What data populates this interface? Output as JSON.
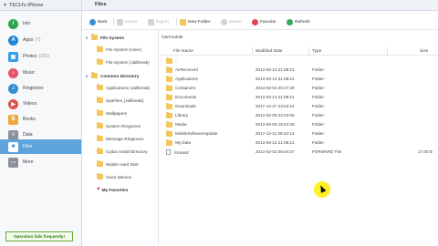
{
  "device": {
    "name": "TECH's iPhone"
  },
  "sidebar": {
    "items": [
      {
        "label": "Info",
        "count": "",
        "color": "#2ea44f"
      },
      {
        "label": "Apps",
        "count": "(7)",
        "color": "#1f86d8"
      },
      {
        "label": "Photos",
        "count": "(202)",
        "color": "#36a0e6"
      },
      {
        "label": "Music",
        "count": "",
        "color": "#e4546a"
      },
      {
        "label": "Ringtones",
        "count": "",
        "color": "#2f8fd6"
      },
      {
        "label": "Videos",
        "count": "",
        "color": "#d9534f"
      },
      {
        "label": "Books",
        "count": "",
        "color": "#f1a73c"
      },
      {
        "label": "Data",
        "count": "",
        "color": "#8a8f99"
      },
      {
        "label": "Files",
        "count": "",
        "color": "#3d8fd1"
      },
      {
        "label": "More",
        "count": "",
        "color": "#8a8f99"
      }
    ],
    "status": "Operation fails frequently!"
  },
  "tabs": {
    "files": "Files"
  },
  "toolbar": {
    "back": "Back",
    "import": "Import",
    "export": "Export",
    "new_folder": "New Folder",
    "delete": "Delete",
    "favorite": "Favorite",
    "refresh": "Refresh"
  },
  "tree": {
    "file_system": "File System",
    "file_system_user": "File System (User)",
    "file_system_jailbreak": "File System (Jailbreak)",
    "common_directory": "Common Directory",
    "common": [
      "Applications (Jailbreak)",
      "SpaFiles (Jailbreak)",
      "Wallpapers",
      "System Ringtones",
      "Message Ringtones",
      "Cydia Install Directory",
      "Mobile Hard Disk",
      "Voice Memos"
    ],
    "my_favorites": "My Favorites"
  },
  "path": "/var/mobile",
  "table": {
    "headers": {
      "name": "File Name",
      "modified": "Modified Date",
      "type": "Type",
      "size": "Size"
    },
    "rows": [
      {
        "name": "..",
        "modified": "",
        "type": "",
        "size": ""
      },
      {
        "name": "AirReceived",
        "modified": "2013-02-13 21:08:21",
        "type": "Folder",
        "size": ""
      },
      {
        "name": "Applications",
        "modified": "2013-02-13 21:08:21",
        "type": "Folder",
        "size": ""
      },
      {
        "name": "Containers",
        "modified": "2013-02-02 20:37:39",
        "type": "Folder",
        "size": ""
      },
      {
        "name": "Documents",
        "modified": "2013-02-13 21:08:21",
        "type": "Folder",
        "size": ""
      },
      {
        "name": "Downloads",
        "modified": "2017-12-27 22:02:24",
        "type": "Folder",
        "size": ""
      },
      {
        "name": "Library",
        "modified": "2013-02-09 22:04:08",
        "type": "Folder",
        "size": ""
      },
      {
        "name": "Media",
        "modified": "2013-02-09 15:24:28",
        "type": "Folder",
        "size": ""
      },
      {
        "name": "MobileSoftwareUpdate",
        "modified": "2017-12-11 09:42:14",
        "type": "Folder",
        "size": ""
      },
      {
        "name": "My Data",
        "modified": "2013-02-12 21:08:21",
        "type": "Folder",
        "size": ""
      },
      {
        "name": ".forward",
        "modified": "2013-02-02 09:44:37",
        "type": "FORWARD File",
        "size": "17.00 B"
      }
    ]
  },
  "colors": {
    "accent": "#5ea3dc",
    "folder": "#f3c55b",
    "status_green": "#2d7a14"
  }
}
